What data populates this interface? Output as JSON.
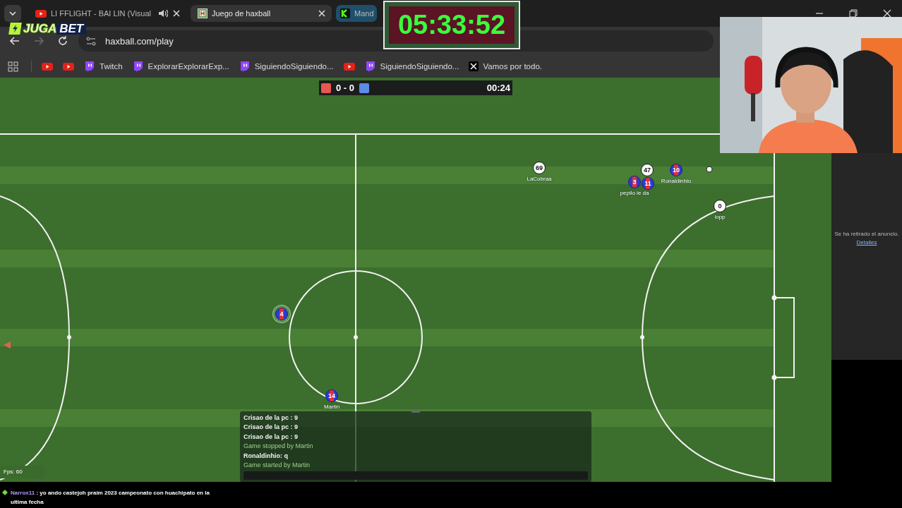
{
  "browser": {
    "tabs": [
      {
        "kind": "youtube",
        "title": "LI FFLIGHT - BAI LIN (Visual",
        "audio": true,
        "selected": false
      },
      {
        "kind": "haxball",
        "title": "Juego de haxball",
        "audio": false,
        "selected": true
      },
      {
        "kind": "kick",
        "title": "Mand",
        "audio": false,
        "selected": false
      }
    ],
    "url": "haxball.com/play",
    "forward_disabled": true,
    "bookmarks": [
      {
        "kind": "youtube"
      },
      {
        "kind": "youtube"
      },
      {
        "kind": "twitch",
        "label": "Twitch"
      },
      {
        "kind": "twitch",
        "label": "ExplorarExplorarExp..."
      },
      {
        "kind": "twitch",
        "label": "SiguiendoSiguiendo..."
      },
      {
        "kind": "youtube"
      },
      {
        "kind": "twitch",
        "label": "SiguiendoSiguiendo..."
      },
      {
        "kind": "x",
        "label": "Vamos por todo."
      }
    ]
  },
  "logo": {
    "lead": "JUGA",
    "tail": "BET"
  },
  "countdown": "05:33:52",
  "game": {
    "score": "0 - 0",
    "time": "00:24",
    "players": [
      {
        "number": "69",
        "name": "LaCobraa",
        "kind": "white",
        "highlighted": false
      },
      {
        "number": "47",
        "kind": "white",
        "highlighted": false
      },
      {
        "number": "10",
        "name": "Ronaldinhio",
        "kind": "striped",
        "highlighted": false
      },
      {
        "number": "3",
        "name": "pepilo le da",
        "kind": "striped",
        "highlighted": false
      },
      {
        "number": "11",
        "kind": "striped",
        "highlighted": false
      },
      {
        "number": "0",
        "name": "lopp",
        "kind": "white",
        "highlighted": false
      },
      {
        "number": "4",
        "kind": "striped",
        "highlighted": true
      },
      {
        "number": "14",
        "name": "Martin",
        "kind": "striped",
        "highlighted": false
      }
    ],
    "chat": [
      {
        "kind": "chat",
        "text": "Crisao de la pc : 9"
      },
      {
        "kind": "chat",
        "text": "Crisao de la pc : 9"
      },
      {
        "kind": "chat",
        "text": "Crisao de la pc : 9"
      },
      {
        "kind": "notice",
        "text": "Game stopped by Martin"
      },
      {
        "kind": "chat",
        "text": "Ronaldinhio: q"
      },
      {
        "kind": "notice",
        "text": "Game started by Martin"
      }
    ],
    "fps": "Fps: 60"
  },
  "ad": {
    "text": "Se ha retirado el anuncio.",
    "link": "Detalles"
  },
  "stream_chat": {
    "user": "Narrox11",
    "message": ": yo ando castejoh praim 2023 campeonato con huachipato en la ultima fecha"
  }
}
